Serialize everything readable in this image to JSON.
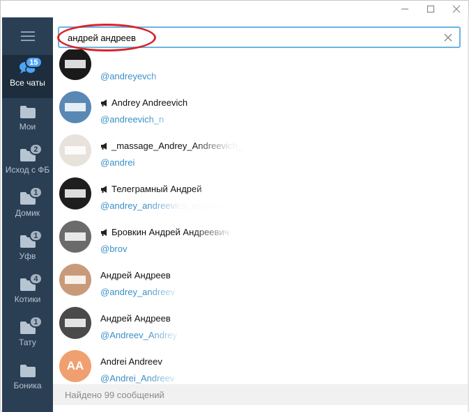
{
  "window": {
    "controls": {
      "minimize": "minimize-icon",
      "maximize": "maximize-icon",
      "close": "close-icon"
    }
  },
  "sidebar": {
    "menu_icon": "hamburger-icon",
    "folders": [
      {
        "label": "Все чаты",
        "badge": "15",
        "icon": "chat-bubbles-icon",
        "active": true
      },
      {
        "label": "Мои",
        "badge": "",
        "icon": "folder-icon",
        "active": false
      },
      {
        "label": "Исход с ФБ",
        "badge": "2",
        "icon": "folder-icon",
        "active": false
      },
      {
        "label": "Домик",
        "badge": "1",
        "icon": "folder-icon",
        "active": false
      },
      {
        "label": "Уфв",
        "badge": "1",
        "icon": "folder-icon",
        "active": false
      },
      {
        "label": "Котики",
        "badge": "4",
        "icon": "folder-icon",
        "active": false
      },
      {
        "label": "Тату",
        "badge": "1",
        "icon": "folder-icon",
        "active": false
      },
      {
        "label": "Боника",
        "badge": "",
        "icon": "folder-icon",
        "active": false
      }
    ]
  },
  "search": {
    "value": "андрей андреев",
    "clear_icon": "clear-x-icon"
  },
  "results": [
    {
      "name": "",
      "handle": "@andreyevch",
      "avatar_initials": "",
      "avatar_color": "#1a1a1a",
      "channel": false
    },
    {
      "name": "Andrey Andreevich",
      "handle": "@andreevich_n",
      "avatar_initials": "",
      "avatar_color": "#5a88b5",
      "channel": true
    },
    {
      "name": "_massage_Andrey_Andreevich_",
      "handle": "@andrei",
      "avatar_initials": "",
      "avatar_color": "#e8e2dc",
      "channel": true
    },
    {
      "name": "Телеграмный Андрей",
      "handle": "@andrey_andreevich_andreev",
      "avatar_initials": "",
      "avatar_color": "#1e1e1e",
      "channel": true
    },
    {
      "name": "Бровкин Андрей Андреевич",
      "handle": "@brov",
      "avatar_initials": "",
      "avatar_color": "#6b6b6b",
      "channel": true
    },
    {
      "name": "Андрей Андреев",
      "handle": "@andrey_andreev",
      "avatar_initials": "",
      "avatar_color": "#c99a7a",
      "channel": false
    },
    {
      "name": "Андрей Андреев",
      "handle": "@Andreev_Andrey",
      "avatar_initials": "",
      "avatar_color": "#4a4a4a",
      "channel": false
    },
    {
      "name": "Andrei Andreev",
      "handle": "@Andrei_Andreev",
      "avatar_initials": "AA",
      "avatar_color": "#f0a070",
      "channel": false
    }
  ],
  "footer": {
    "text": "Найдено 99 сообщений"
  }
}
